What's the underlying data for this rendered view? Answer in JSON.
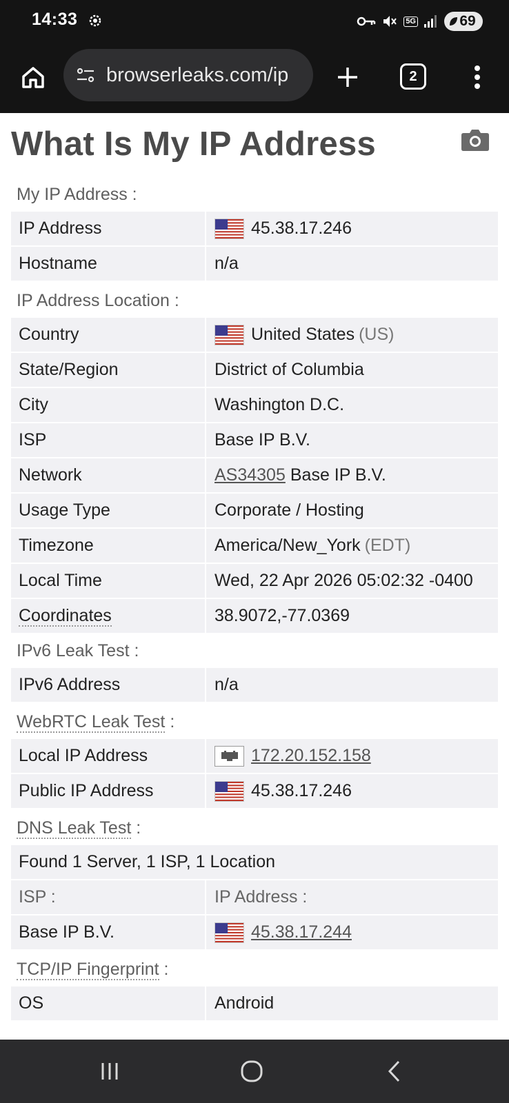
{
  "status_bar": {
    "time": "14:33",
    "network": "5G",
    "battery": "69",
    "icons": [
      "settings-icon",
      "vpn-key-icon",
      "mute-icon",
      "5g-icon",
      "signal-icon",
      "battery-icon"
    ]
  },
  "browser": {
    "url": "browserleaks.com/ip",
    "tab_count": "2",
    "icons": [
      "home-icon",
      "site-settings-icon",
      "plus-icon",
      "tabs-icon",
      "more-icon"
    ]
  },
  "page": {
    "title": "What Is My IP Address",
    "sections": {
      "my_ip": {
        "heading": "My IP Address :",
        "rows": [
          {
            "label": "IP Address",
            "value": "45.38.17.246"
          },
          {
            "label": "Hostname",
            "value": "n/a"
          }
        ]
      },
      "location": {
        "heading": "IP Address Location :",
        "rows": [
          {
            "label": "Country",
            "value": "United States",
            "extra": "(US)"
          },
          {
            "label": "State/Region",
            "value": "District of Columbia"
          },
          {
            "label": "City",
            "value": "Washington D.C."
          },
          {
            "label": "ISP",
            "value": "Base IP B.V."
          },
          {
            "label": "Network",
            "link": "AS34305",
            "value": "Base IP B.V."
          },
          {
            "label": "Usage Type",
            "value": "Corporate / Hosting"
          },
          {
            "label": "Timezone",
            "value": "America/New_York",
            "extra": "(EDT)"
          },
          {
            "label": "Local Time",
            "value": "Wed, 22 Apr 2026 05:02:32 -0400"
          },
          {
            "label": "Coordinates",
            "value": "38.9072,-77.0369"
          }
        ]
      },
      "ipv6": {
        "heading": "IPv6 Leak Test :",
        "rows": [
          {
            "label": "IPv6 Address",
            "value": "n/a"
          }
        ]
      },
      "webrtc": {
        "heading": "WebRTC Leak Test",
        "colon": " :",
        "rows": [
          {
            "label": "Local IP Address",
            "value": "172.20.152.158"
          },
          {
            "label": "Public IP Address",
            "value": "45.38.17.246"
          }
        ]
      },
      "dns": {
        "heading": "DNS Leak Test",
        "colon": " :",
        "summary": "Found 1 Server, 1 ISP, 1 Location",
        "col_isp": "ISP :",
        "col_ip": "IP Address :",
        "rows": [
          {
            "label": "Base IP B.V.",
            "value": "45.38.17.244"
          }
        ]
      },
      "tcpip": {
        "heading": "TCP/IP Fingerprint",
        "colon": " :",
        "rows": [
          {
            "label": "OS",
            "value": "Android"
          }
        ]
      }
    }
  },
  "nav_bar": {
    "icons": [
      "recents-icon",
      "home-circle-icon",
      "back-icon"
    ]
  },
  "colors": {
    "status_bg": "#141414",
    "url_pill": "#2f2f31",
    "row_bg": "#f1f1f4",
    "nav_bg": "#2b2b2d",
    "title": "#4a4a4a"
  }
}
